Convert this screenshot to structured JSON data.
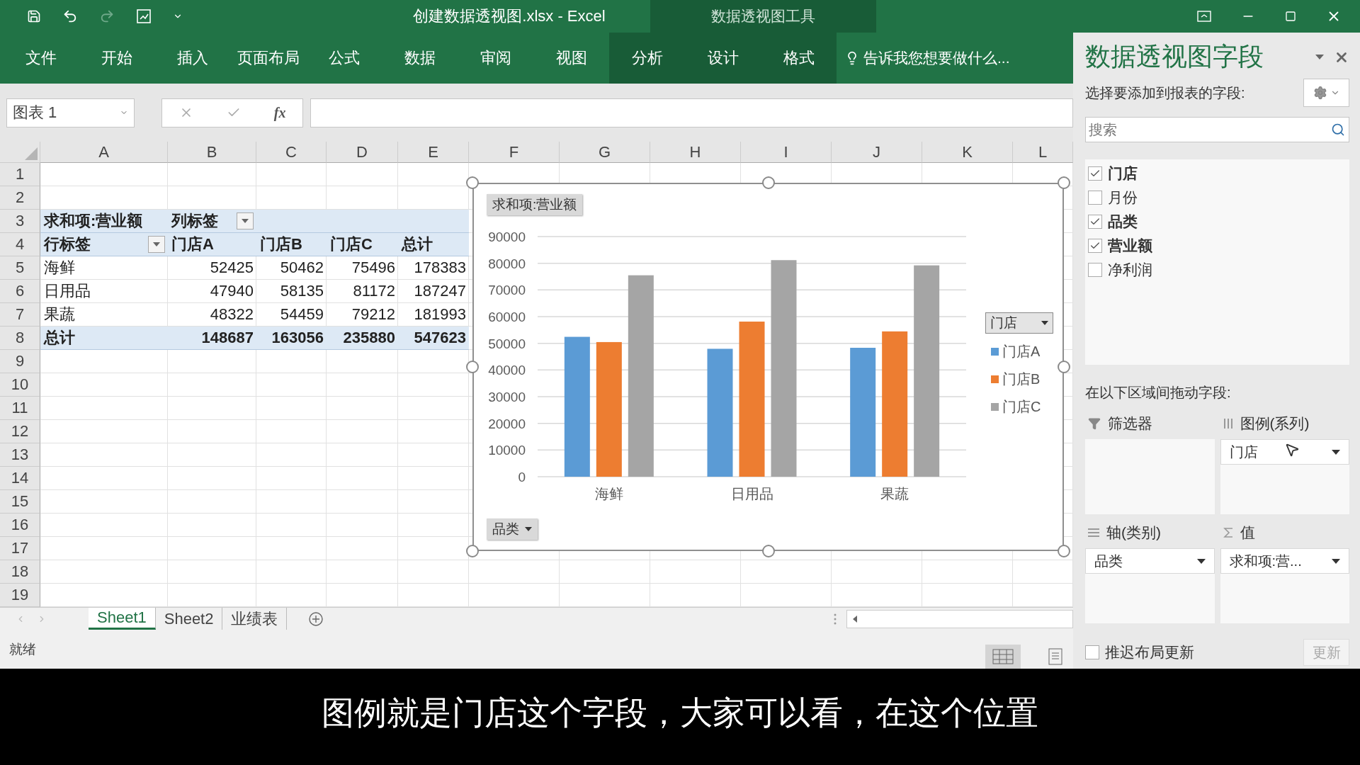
{
  "window": {
    "title": "创建数据透视图.xlsx - Excel",
    "context_group": "数据透视图工具"
  },
  "ribbon": {
    "tabs": [
      {
        "label": "文件",
        "selected": false,
        "kind": "file"
      },
      {
        "label": "开始",
        "selected": false,
        "kind": "main"
      },
      {
        "label": "插入",
        "selected": false,
        "kind": "main"
      },
      {
        "label": "页面布局",
        "selected": false,
        "kind": "main"
      },
      {
        "label": "公式",
        "selected": false,
        "kind": "main"
      },
      {
        "label": "数据",
        "selected": false,
        "kind": "main"
      },
      {
        "label": "审阅",
        "selected": false,
        "kind": "main"
      },
      {
        "label": "视图",
        "selected": false,
        "kind": "main"
      },
      {
        "label": "分析",
        "selected": false,
        "kind": "context"
      },
      {
        "label": "设计",
        "selected": false,
        "kind": "context"
      },
      {
        "label": "格式",
        "selected": false,
        "kind": "context"
      }
    ],
    "tell_me": "告诉我您想要做什么..."
  },
  "formula_bar": {
    "name_box": "图表 1",
    "fx": "fx"
  },
  "sheet": {
    "columns": [
      "A",
      "B",
      "C",
      "D",
      "E",
      "F",
      "G",
      "H",
      "I",
      "J",
      "K",
      "L"
    ],
    "rows": [
      "1",
      "2",
      "3",
      "4",
      "5",
      "6",
      "7",
      "8",
      "9",
      "10",
      "11",
      "12",
      "13",
      "14",
      "15",
      "16",
      "17",
      "18",
      "19"
    ]
  },
  "pivot": {
    "value_label": "求和项:营业额",
    "column_label": "列标签",
    "row_label": "行标签",
    "columns": [
      "门店A",
      "门店B",
      "门店C",
      "总计"
    ],
    "rows": [
      {
        "label": "海鲜",
        "values": [
          "52425",
          "50462",
          "75496",
          "178383"
        ]
      },
      {
        "label": "日用品",
        "values": [
          "47940",
          "58135",
          "81172",
          "187247"
        ]
      },
      {
        "label": "果蔬",
        "values": [
          "48322",
          "54459",
          "79212",
          "181993"
        ]
      }
    ],
    "total": {
      "label": "总计",
      "values": [
        "148687",
        "163056",
        "235880",
        "547623"
      ]
    }
  },
  "chart": {
    "value_button": "求和项:营业额",
    "axis_button": "品类",
    "legend_button": "门店",
    "chart_data": {
      "type": "bar",
      "categories": [
        "海鲜",
        "日用品",
        "果蔬"
      ],
      "series": [
        {
          "name": "门店A",
          "color": "#5b9bd5",
          "values": [
            52425,
            47940,
            48322
          ]
        },
        {
          "name": "门店B",
          "color": "#ed7d31",
          "values": [
            50462,
            58135,
            54459
          ]
        },
        {
          "name": "门店C",
          "color": "#a5a5a5",
          "values": [
            75496,
            81172,
            79212
          ]
        }
      ],
      "ylim": [
        0,
        90000
      ],
      "grid": true,
      "yticks": [
        0,
        10000,
        20000,
        30000,
        40000,
        50000,
        60000,
        70000,
        80000,
        90000
      ]
    }
  },
  "sheet_tabs": [
    {
      "label": "Sheet1",
      "selected": true
    },
    {
      "label": "Sheet2",
      "selected": false
    },
    {
      "label": "业绩表",
      "selected": false
    }
  ],
  "status_bar": {
    "text": "就绪"
  },
  "field_pane": {
    "title": "数据透视图字段",
    "prompt": "选择要添加到报表的字段:",
    "search": {
      "placeholder": "搜索"
    },
    "fields": [
      {
        "label": "门店",
        "checked": true
      },
      {
        "label": "月份",
        "checked": false
      },
      {
        "label": "品类",
        "checked": true
      },
      {
        "label": "营业额",
        "checked": true
      },
      {
        "label": "净利润",
        "checked": false
      }
    ],
    "areas_prompt": "在以下区域间拖动字段:",
    "areas": [
      {
        "kind": "filter",
        "label": "筛选器"
      },
      {
        "kind": "legend",
        "label": "图例(系列)",
        "items": [
          "门店"
        ]
      },
      {
        "kind": "axis",
        "label": "轴(类别)",
        "items": [
          "品类"
        ]
      },
      {
        "kind": "values",
        "label": "值",
        "items": [
          "求和项:营..."
        ]
      }
    ],
    "defer": {
      "label": "推迟布局更新",
      "checked": false
    },
    "update_button": {
      "label": "更新",
      "disabled": true
    }
  },
  "subtitle": "图例就是门店这个字段，大家可以看，在这个位置"
}
